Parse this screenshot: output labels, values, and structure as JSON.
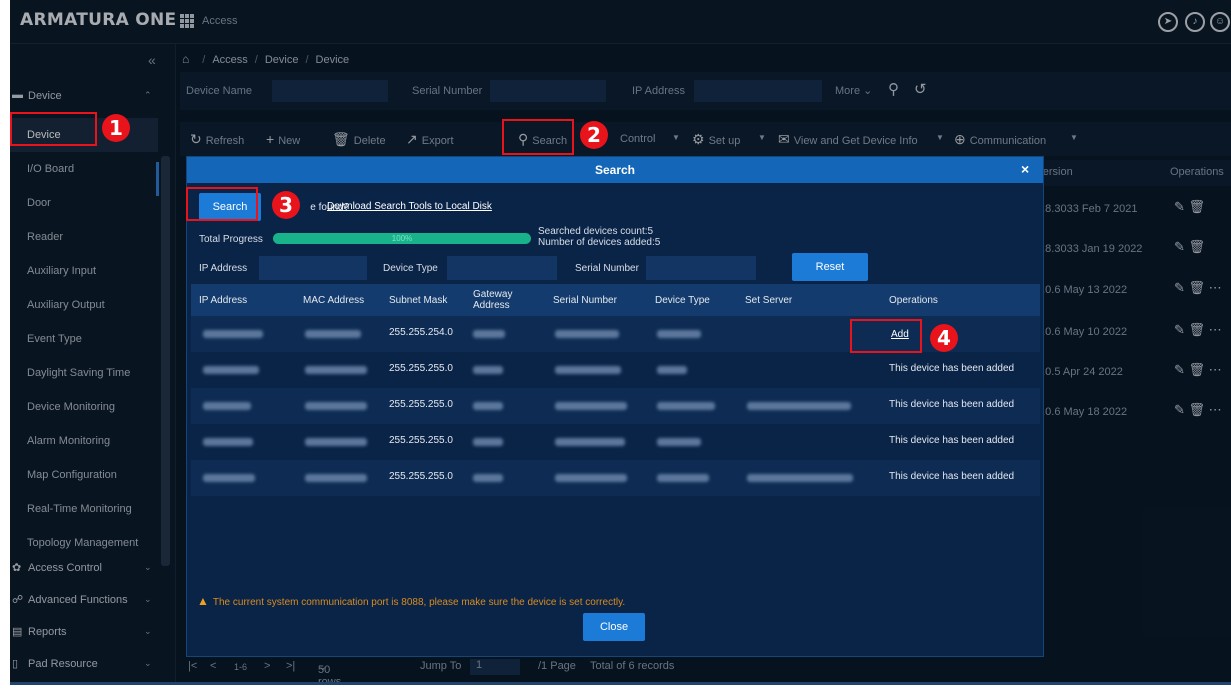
{
  "app": {
    "logo": "ARMATURA ONE",
    "module": "Access"
  },
  "top_icons": [
    "compass-icon",
    "bell-icon",
    "user-icon"
  ],
  "sidebar": {
    "collapse_glyph": "«",
    "device_section": "Device",
    "items": [
      "Device",
      "I/O Board",
      "Door",
      "Reader",
      "Auxiliary Input",
      "Auxiliary Output",
      "Event Type",
      "Daylight Saving Time",
      "Device Monitoring",
      "Alarm Monitoring",
      "Map Configuration",
      "Real-Time Monitoring",
      "Topology Management"
    ],
    "active_item": "Device",
    "sections": [
      "Access Control",
      "Advanced Functions",
      "Reports",
      "Pad Resource"
    ]
  },
  "breadcrumb": [
    "Access",
    "Device",
    "Device"
  ],
  "filters": {
    "device_name": "Device Name",
    "serial_number": "Serial Number",
    "ip_address": "IP Address",
    "more": "More"
  },
  "toolbar": {
    "refresh": "Refresh",
    "new": "New",
    "delete": "Delete",
    "export": "Export",
    "search": "Search",
    "control": "Control",
    "setup": "Set up",
    "view_info": "View and Get Device Info",
    "communication": "Communication"
  },
  "bg_table": {
    "version_header": "Version",
    "operations_header": "Operations",
    "versions": [
      "7.8.3033 Feb 7 2021",
      "7.8.3033 Jan 19 2022",
      "0.0.6 May 13 2022",
      "0.0.6 May 10 2022",
      "0.0.5 Apr 24 2022",
      "0.0.6 May 18 2022"
    ]
  },
  "pagination": {
    "range": "1-6",
    "rows_per_page": "50 rows per page",
    "jump_to": "Jump To",
    "page_input": "1",
    "page_total": "/1 Page",
    "total": "Total of 6 records"
  },
  "modal": {
    "title": "Search",
    "close_glyph": "×",
    "search_button": "Search",
    "not_found_prefix": "N",
    "not_found_text": "e found?",
    "download_link": "Download Search Tools to Local Disk",
    "total_progress_label": "Total Progress",
    "progress": 100,
    "progress_text": "100%",
    "searched_count": "Searched devices count:5",
    "added_count": "Number of devices added:5",
    "filter_ip": "IP Address",
    "filter_type": "Device Type",
    "filter_serial": "Serial Number",
    "reset_button": "Reset",
    "columns": [
      "IP Address",
      "MAC Address",
      "Subnet Mask",
      "Gateway Address",
      "Serial Number",
      "Device Type",
      "Set Server",
      "Operations"
    ],
    "rows": [
      {
        "subnet": "255.255.254.0",
        "operation": "Add"
      },
      {
        "subnet": "255.255.255.0",
        "operation": "This device has been added"
      },
      {
        "subnet": "255.255.255.0",
        "operation": "This device has been added"
      },
      {
        "subnet": "255.255.255.0",
        "operation": "This device has been added"
      },
      {
        "subnet": "255.255.255.0",
        "operation": "This device has been added"
      }
    ],
    "warning": "The current system communication port is 8088, please make sure the device is set correctly.",
    "close_button": "Close"
  },
  "annotations": [
    "1",
    "2",
    "3",
    "4"
  ],
  "colors": {
    "accent": "#1b7bd6",
    "progress": "#18b38a",
    "annotation": "#e8131b",
    "warning": "#d98b1e"
  }
}
